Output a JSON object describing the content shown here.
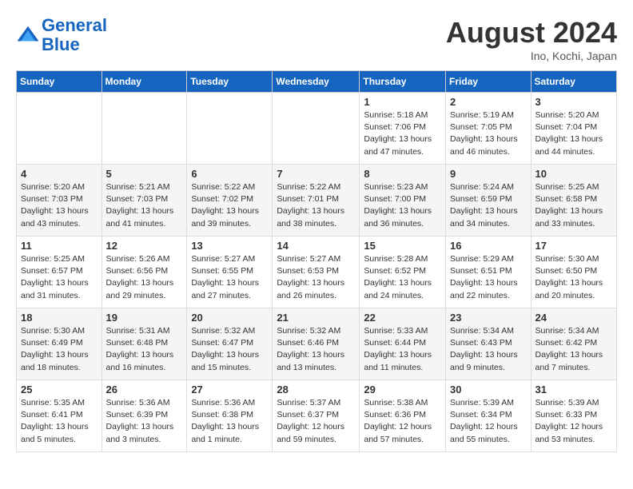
{
  "logo": {
    "line1": "General",
    "line2": "Blue"
  },
  "title": "August 2024",
  "location": "Ino, Kochi, Japan",
  "days_of_week": [
    "Sunday",
    "Monday",
    "Tuesday",
    "Wednesday",
    "Thursday",
    "Friday",
    "Saturday"
  ],
  "weeks": [
    [
      {
        "day": "",
        "info": ""
      },
      {
        "day": "",
        "info": ""
      },
      {
        "day": "",
        "info": ""
      },
      {
        "day": "",
        "info": ""
      },
      {
        "day": "1",
        "info": "Sunrise: 5:18 AM\nSunset: 7:06 PM\nDaylight: 13 hours\nand 47 minutes."
      },
      {
        "day": "2",
        "info": "Sunrise: 5:19 AM\nSunset: 7:05 PM\nDaylight: 13 hours\nand 46 minutes."
      },
      {
        "day": "3",
        "info": "Sunrise: 5:20 AM\nSunset: 7:04 PM\nDaylight: 13 hours\nand 44 minutes."
      }
    ],
    [
      {
        "day": "4",
        "info": "Sunrise: 5:20 AM\nSunset: 7:03 PM\nDaylight: 13 hours\nand 43 minutes."
      },
      {
        "day": "5",
        "info": "Sunrise: 5:21 AM\nSunset: 7:03 PM\nDaylight: 13 hours\nand 41 minutes."
      },
      {
        "day": "6",
        "info": "Sunrise: 5:22 AM\nSunset: 7:02 PM\nDaylight: 13 hours\nand 39 minutes."
      },
      {
        "day": "7",
        "info": "Sunrise: 5:22 AM\nSunset: 7:01 PM\nDaylight: 13 hours\nand 38 minutes."
      },
      {
        "day": "8",
        "info": "Sunrise: 5:23 AM\nSunset: 7:00 PM\nDaylight: 13 hours\nand 36 minutes."
      },
      {
        "day": "9",
        "info": "Sunrise: 5:24 AM\nSunset: 6:59 PM\nDaylight: 13 hours\nand 34 minutes."
      },
      {
        "day": "10",
        "info": "Sunrise: 5:25 AM\nSunset: 6:58 PM\nDaylight: 13 hours\nand 33 minutes."
      }
    ],
    [
      {
        "day": "11",
        "info": "Sunrise: 5:25 AM\nSunset: 6:57 PM\nDaylight: 13 hours\nand 31 minutes."
      },
      {
        "day": "12",
        "info": "Sunrise: 5:26 AM\nSunset: 6:56 PM\nDaylight: 13 hours\nand 29 minutes."
      },
      {
        "day": "13",
        "info": "Sunrise: 5:27 AM\nSunset: 6:55 PM\nDaylight: 13 hours\nand 27 minutes."
      },
      {
        "day": "14",
        "info": "Sunrise: 5:27 AM\nSunset: 6:53 PM\nDaylight: 13 hours\nand 26 minutes."
      },
      {
        "day": "15",
        "info": "Sunrise: 5:28 AM\nSunset: 6:52 PM\nDaylight: 13 hours\nand 24 minutes."
      },
      {
        "day": "16",
        "info": "Sunrise: 5:29 AM\nSunset: 6:51 PM\nDaylight: 13 hours\nand 22 minutes."
      },
      {
        "day": "17",
        "info": "Sunrise: 5:30 AM\nSunset: 6:50 PM\nDaylight: 13 hours\nand 20 minutes."
      }
    ],
    [
      {
        "day": "18",
        "info": "Sunrise: 5:30 AM\nSunset: 6:49 PM\nDaylight: 13 hours\nand 18 minutes."
      },
      {
        "day": "19",
        "info": "Sunrise: 5:31 AM\nSunset: 6:48 PM\nDaylight: 13 hours\nand 16 minutes."
      },
      {
        "day": "20",
        "info": "Sunrise: 5:32 AM\nSunset: 6:47 PM\nDaylight: 13 hours\nand 15 minutes."
      },
      {
        "day": "21",
        "info": "Sunrise: 5:32 AM\nSunset: 6:46 PM\nDaylight: 13 hours\nand 13 minutes."
      },
      {
        "day": "22",
        "info": "Sunrise: 5:33 AM\nSunset: 6:44 PM\nDaylight: 13 hours\nand 11 minutes."
      },
      {
        "day": "23",
        "info": "Sunrise: 5:34 AM\nSunset: 6:43 PM\nDaylight: 13 hours\nand 9 minutes."
      },
      {
        "day": "24",
        "info": "Sunrise: 5:34 AM\nSunset: 6:42 PM\nDaylight: 13 hours\nand 7 minutes."
      }
    ],
    [
      {
        "day": "25",
        "info": "Sunrise: 5:35 AM\nSunset: 6:41 PM\nDaylight: 13 hours\nand 5 minutes."
      },
      {
        "day": "26",
        "info": "Sunrise: 5:36 AM\nSunset: 6:39 PM\nDaylight: 13 hours\nand 3 minutes."
      },
      {
        "day": "27",
        "info": "Sunrise: 5:36 AM\nSunset: 6:38 PM\nDaylight: 13 hours\nand 1 minute."
      },
      {
        "day": "28",
        "info": "Sunrise: 5:37 AM\nSunset: 6:37 PM\nDaylight: 12 hours\nand 59 minutes."
      },
      {
        "day": "29",
        "info": "Sunrise: 5:38 AM\nSunset: 6:36 PM\nDaylight: 12 hours\nand 57 minutes."
      },
      {
        "day": "30",
        "info": "Sunrise: 5:39 AM\nSunset: 6:34 PM\nDaylight: 12 hours\nand 55 minutes."
      },
      {
        "day": "31",
        "info": "Sunrise: 5:39 AM\nSunset: 6:33 PM\nDaylight: 12 hours\nand 53 minutes."
      }
    ]
  ]
}
